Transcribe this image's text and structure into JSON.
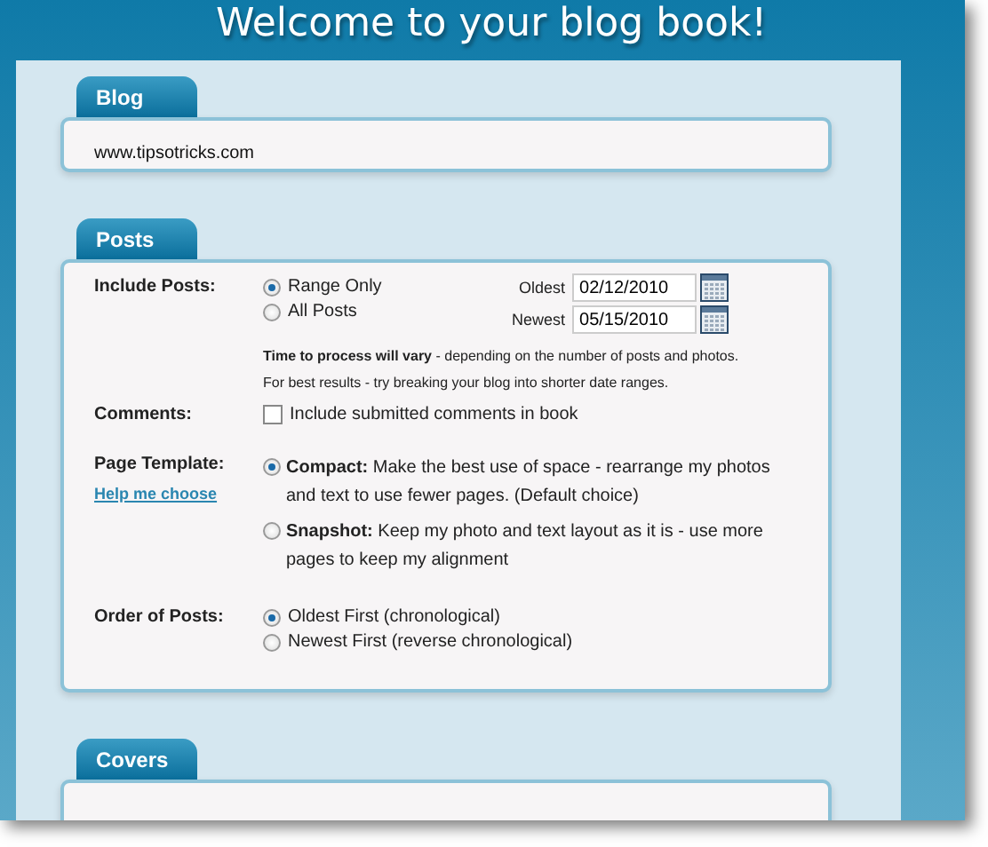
{
  "title": "Welcome to your blog book!",
  "blog": {
    "tab": "Blog",
    "url": "www.tipsotricks.com"
  },
  "posts": {
    "tab": "Posts",
    "include_posts": {
      "label": "Include Posts:",
      "options": [
        {
          "label": "Range Only",
          "selected": true
        },
        {
          "label": "All Posts",
          "selected": false
        }
      ],
      "dates": [
        {
          "label": "Oldest",
          "value": "02/12/2010"
        },
        {
          "label": "Newest",
          "value": "05/15/2010"
        }
      ],
      "notes": [
        "**Time to process will vary** - depending on the number of posts and photos.",
        "For best results - try breaking your blog into shorter date ranges."
      ]
    },
    "comments": {
      "label": "Comments:",
      "option": "Include submitted comments in book",
      "checked": false
    },
    "page_template": {
      "label": "Page Template:",
      "help_link": "Help me choose",
      "options": [
        {
          "name": "Compact:",
          "description": "Make the best use of space - rearrange my photos and text to use fewer pages. (Default choice)",
          "selected": true
        },
        {
          "name": "Snapshot:",
          "description": "Keep my photo and text layout as it is - use more pages to keep my alignment",
          "selected": false
        }
      ]
    },
    "order": {
      "label": "Order of Posts:",
      "options": [
        {
          "label": "Oldest First (chronological)",
          "selected": true
        },
        {
          "label": "Newest First (reverse chronological)",
          "selected": false
        }
      ]
    }
  },
  "covers": {
    "tab": "Covers"
  }
}
